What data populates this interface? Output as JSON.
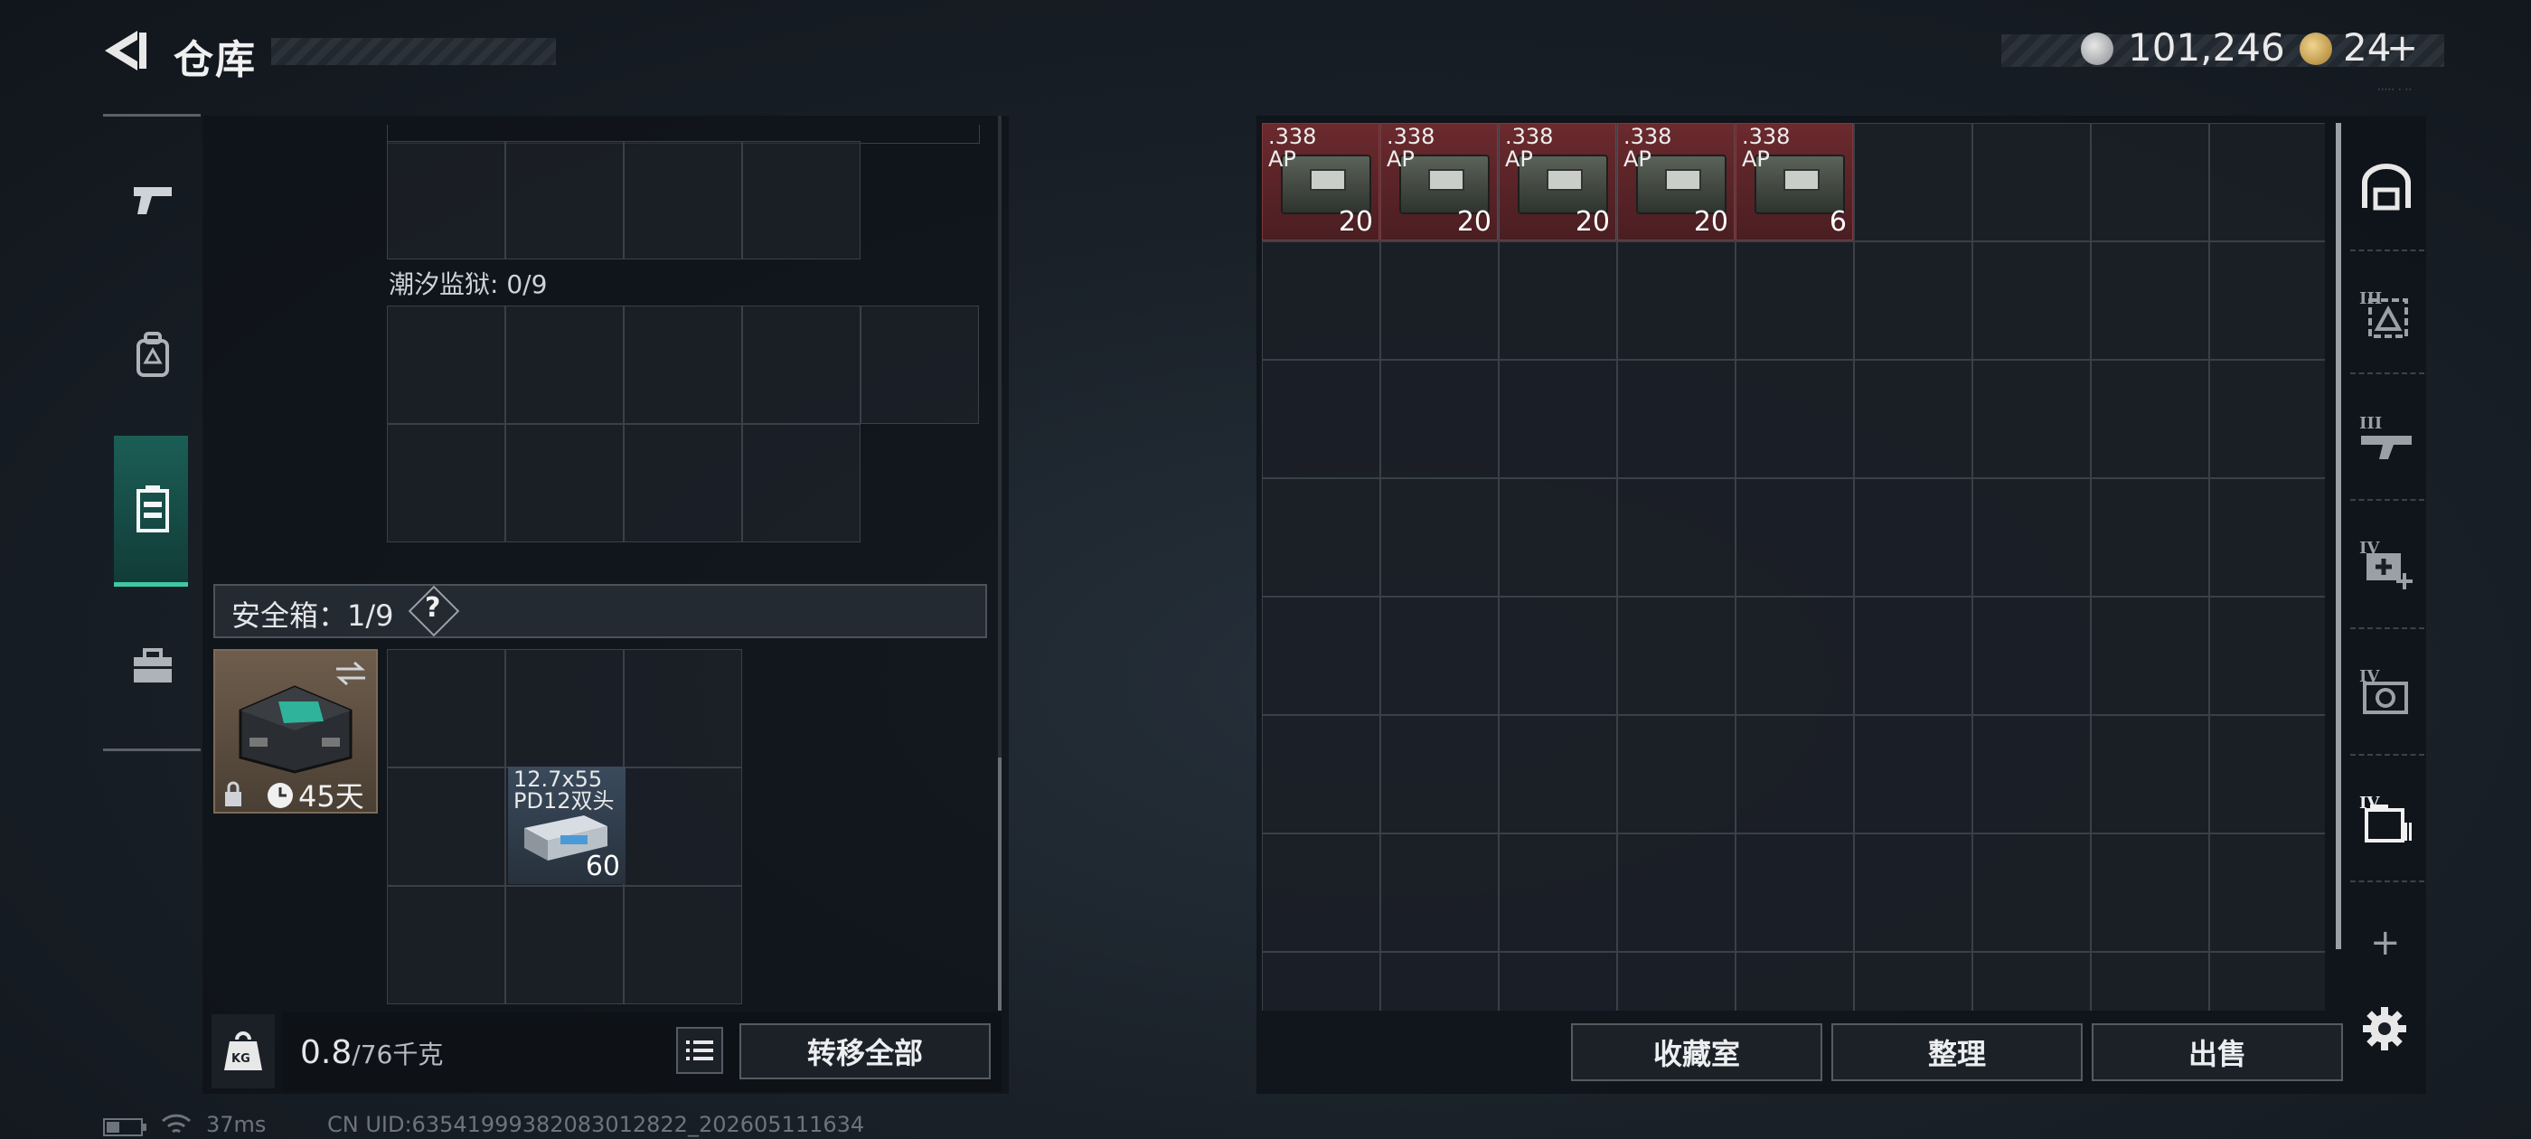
{
  "header": {
    "title": "仓库",
    "silver_amount": "101,246",
    "gold_amount": "24",
    "plus_label": "+",
    "tiny_mark": "····· · ··"
  },
  "sidebar": {
    "items": [
      {
        "name": "weapons",
        "icon": "pistol-icon"
      },
      {
        "name": "backpack",
        "icon": "backpack-icon"
      },
      {
        "name": "containers",
        "icon": "container-icon",
        "active": true
      },
      {
        "name": "toolbox",
        "icon": "toolbox-icon"
      }
    ]
  },
  "left_panel": {
    "prison_label": "潮汐监狱: 0/9",
    "safebox_label": "安全箱：1/9",
    "help_label": "?",
    "safebox": {
      "duration": "45天"
    },
    "left_item": {
      "caliber_line1": "12.7x55",
      "caliber_line2": "PD12双头",
      "quantity": "60"
    },
    "weight_current": "0.8",
    "weight_max": "/76千克",
    "weight_icon_text": "KG",
    "transfer_all_label": "转移全部"
  },
  "right_panel": {
    "ammo_items": [
      {
        "caliber_line1": ".338",
        "caliber_line2": "AP",
        "quantity": "20"
      },
      {
        "caliber_line1": ".338",
        "caliber_line2": "AP",
        "quantity": "20"
      },
      {
        "caliber_line1": ".338",
        "caliber_line2": "AP",
        "quantity": "20"
      },
      {
        "caliber_line1": ".338",
        "caliber_line2": "AP",
        "quantity": "20"
      },
      {
        "caliber_line1": ".338",
        "caliber_line2": "AP",
        "quantity": "6"
      }
    ],
    "buttons": {
      "collection": "收藏室",
      "organize": "整理",
      "sell": "出售"
    },
    "side_tabs": [
      {
        "icon": "home-vault-icon",
        "tier": ""
      },
      {
        "icon": "helmet-tier-icon",
        "tier": "III"
      },
      {
        "icon": "armor-tier-icon",
        "tier": "III"
      },
      {
        "icon": "medkit-tier-icon",
        "tier": "IV"
      },
      {
        "icon": "gear-tier-icon",
        "tier": "IV"
      },
      {
        "icon": "container-tier-icon",
        "tier": "IV"
      }
    ],
    "add_label": "+"
  },
  "status_bar": {
    "ping": "37ms",
    "uid": "CN UID:63541999382083012822_202605111634"
  },
  "colors": {
    "accent": "#3ec9a4",
    "ammo_bg": "#6b2a2e"
  }
}
